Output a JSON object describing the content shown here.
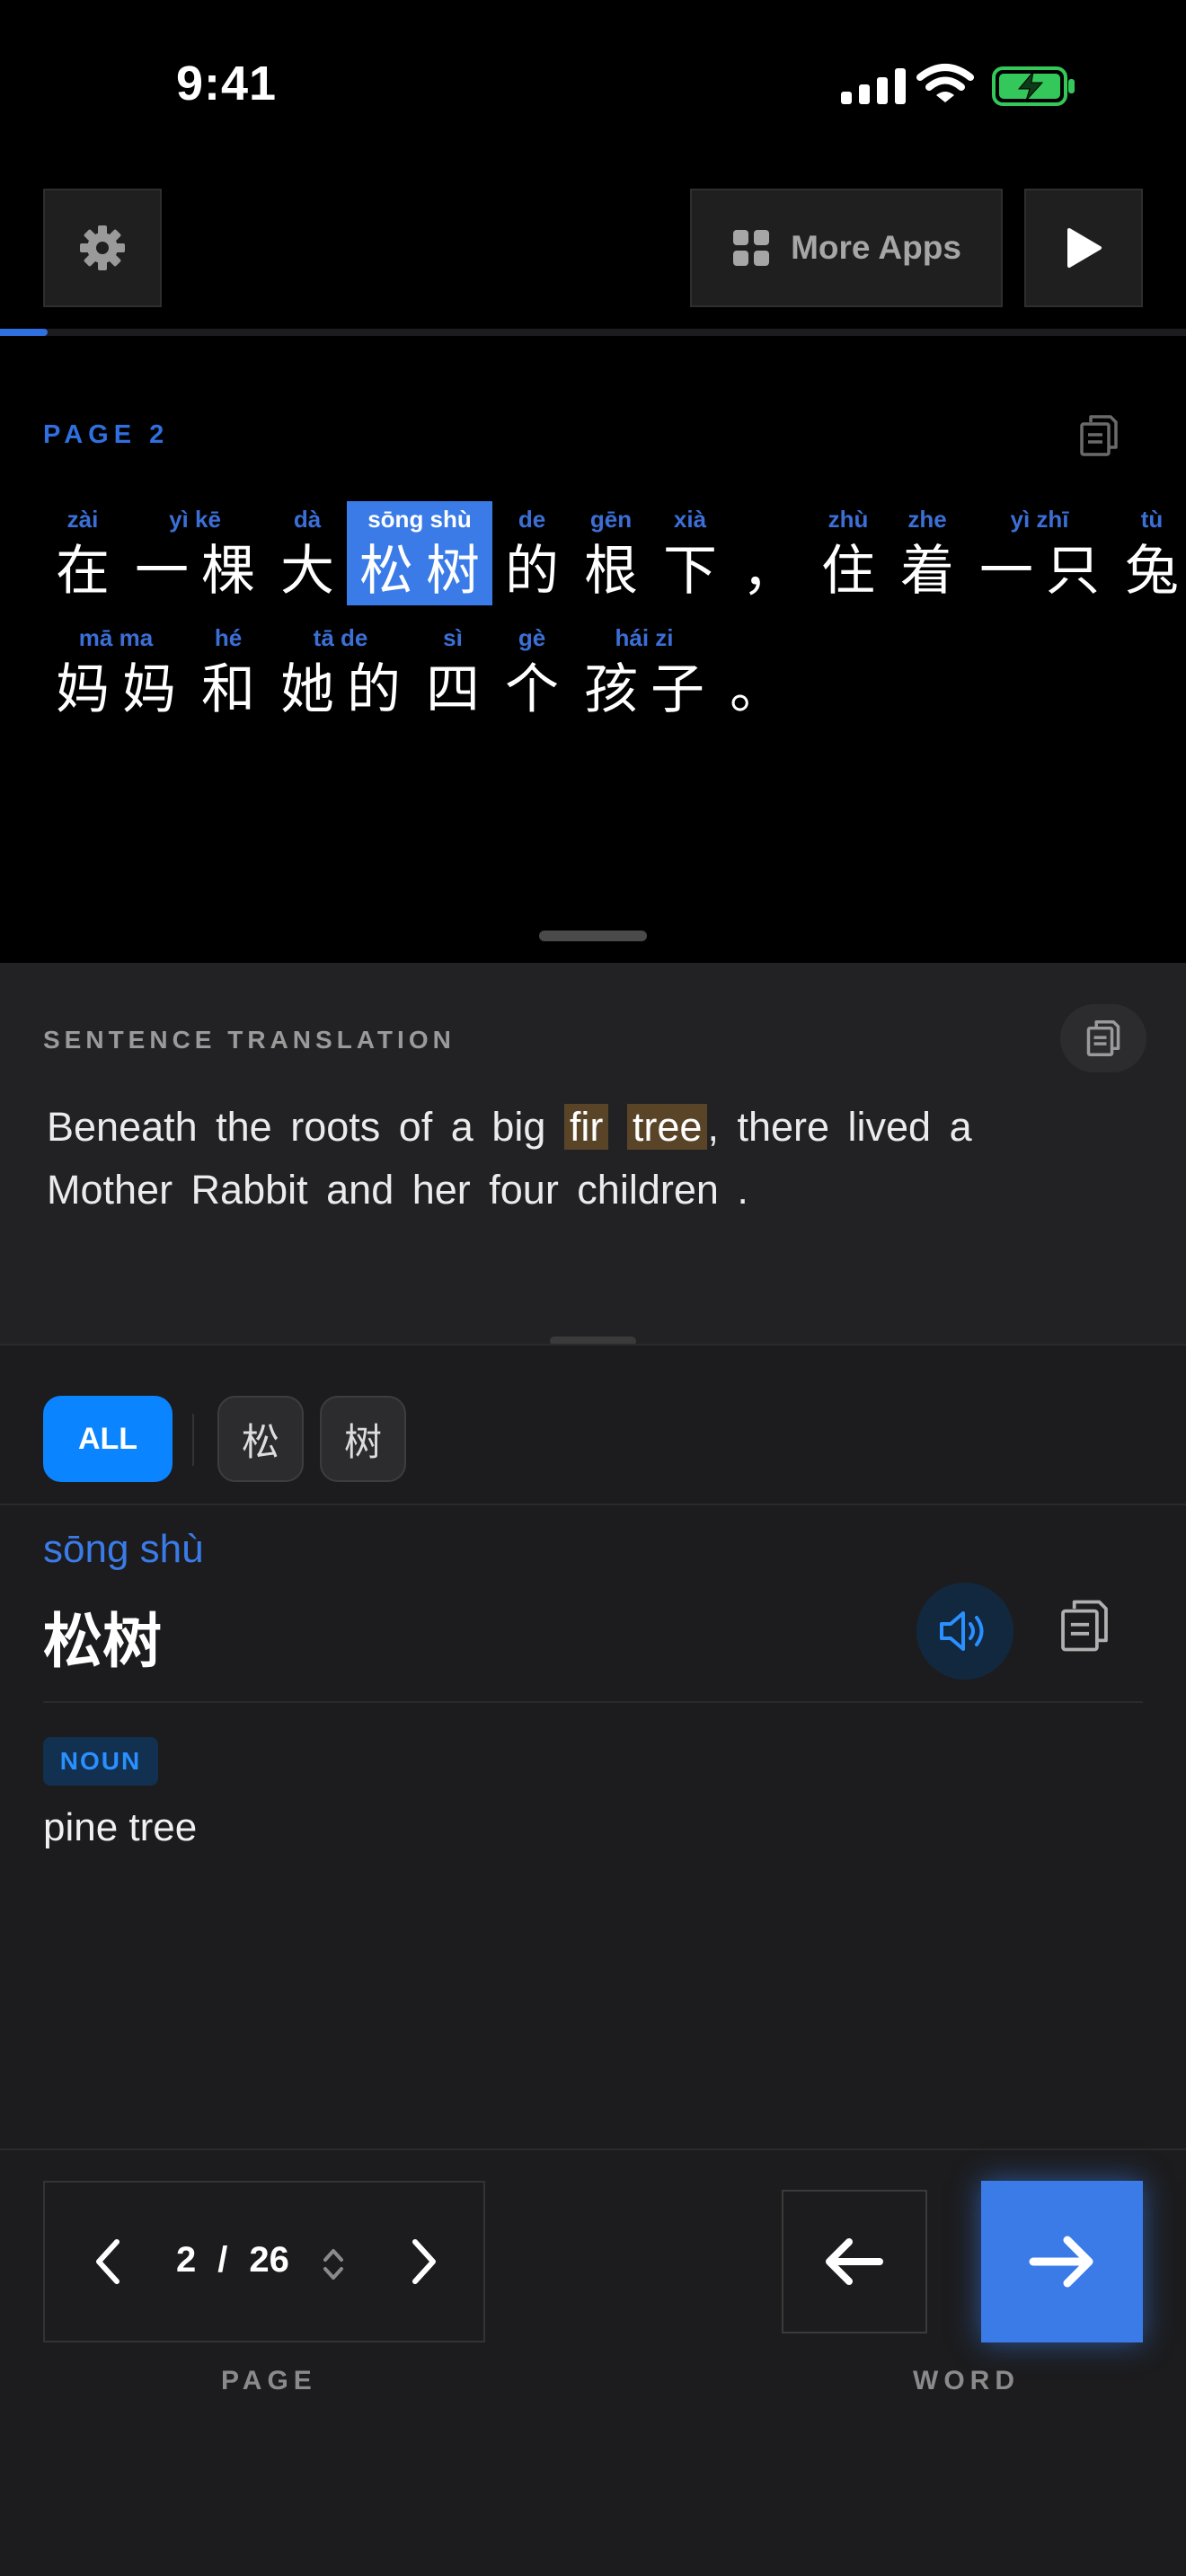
{
  "status_bar": {
    "time": "9:41"
  },
  "toolbar": {
    "more_apps_label": "More Apps"
  },
  "reader": {
    "progress_fraction": 0.04,
    "page_label": "PAGE  2",
    "lines": [
      [
        {
          "py": "zài",
          "hz": "在"
        },
        {
          "py": "yì kē",
          "hz": "一棵"
        },
        {
          "py": "dà",
          "hz": "大"
        },
        {
          "py": "sōng shù",
          "hz": "松树",
          "highlight": true
        },
        {
          "py": "de",
          "hz": "的"
        },
        {
          "py": "gēn",
          "hz": "根"
        },
        {
          "py": "xià",
          "hz": "下"
        },
        {
          "py": "",
          "hz": "，"
        },
        {
          "py": "zhù",
          "hz": "住"
        },
        {
          "py": "zhe",
          "hz": "着"
        },
        {
          "py": "yì zhī",
          "hz": "一只"
        },
        {
          "py": "tù",
          "hz": "兔"
        }
      ],
      [
        {
          "py": "mā ma",
          "hz": "妈妈"
        },
        {
          "py": "hé",
          "hz": "和"
        },
        {
          "py": "tā de",
          "hz": "她的"
        },
        {
          "py": "sì",
          "hz": "四"
        },
        {
          "py": "gè",
          "hz": "个"
        },
        {
          "py": "hái zi",
          "hz": "孩子"
        },
        {
          "py": "",
          "hz": "。"
        }
      ]
    ]
  },
  "translation": {
    "heading": "SENTENCE TRANSLATION",
    "before": "Beneath the roots of a big ",
    "mark1": "fir",
    "mark2": "tree",
    "after": ", there lived a Mother Rabbit and her four children ."
  },
  "dictionary": {
    "filter_all": "ALL",
    "filter_chars": [
      "松",
      "树"
    ],
    "pinyin": "sōng shù",
    "hanzi": "松树",
    "pos": "NOUN",
    "definition": "pine tree"
  },
  "navigation": {
    "current_page": "2",
    "separator": "/",
    "total_pages": "26",
    "page_caption": "PAGE",
    "word_caption": "WORD"
  },
  "colors": {
    "accent_blue": "#3a7be8",
    "pill_blue": "#0a84ff",
    "highlight_brown": "#5a4428",
    "battery_green": "#34c759"
  }
}
